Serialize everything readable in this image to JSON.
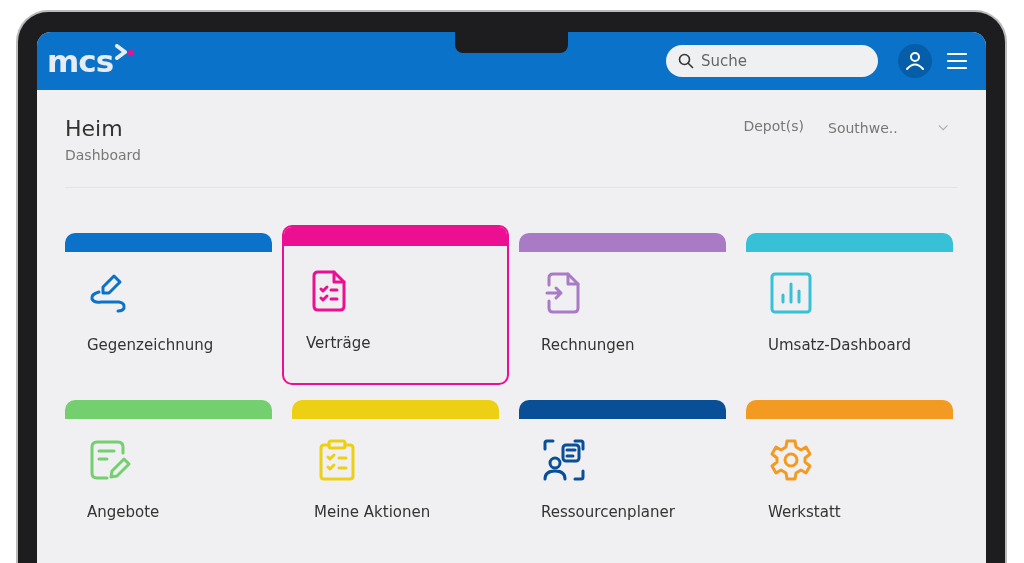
{
  "header": {
    "logo": "mcs",
    "search": {
      "placeholder": "Suche"
    }
  },
  "page": {
    "title": "Heim",
    "subtitle": "Dashboard",
    "depot_label": "Depot(s)",
    "depot_value": "Southwe.."
  },
  "tiles": [
    {
      "label": "Gegenzeichnung",
      "kind": "signature",
      "color": "#0a72c8",
      "selected": false
    },
    {
      "label": "Verträge",
      "kind": "contract",
      "color": "#ec0f92",
      "selected": true
    },
    {
      "label": "Rechnungen",
      "kind": "invoice",
      "color": "#a97bc4",
      "selected": false
    },
    {
      "label": "Umsatz-Dashboard",
      "kind": "chart",
      "color": "#36c1d6",
      "selected": false
    },
    {
      "label": "Angebote",
      "kind": "offer",
      "color": "#74d06e",
      "selected": false
    },
    {
      "label": "Meine Aktionen",
      "kind": "clipboard",
      "color": "#edcf14",
      "selected": false
    },
    {
      "label": "Ressourcenplaner",
      "kind": "planner",
      "color": "#084f98",
      "selected": false
    },
    {
      "label": "Werkstatt",
      "kind": "gear",
      "color": "#f39a22",
      "selected": false
    }
  ]
}
